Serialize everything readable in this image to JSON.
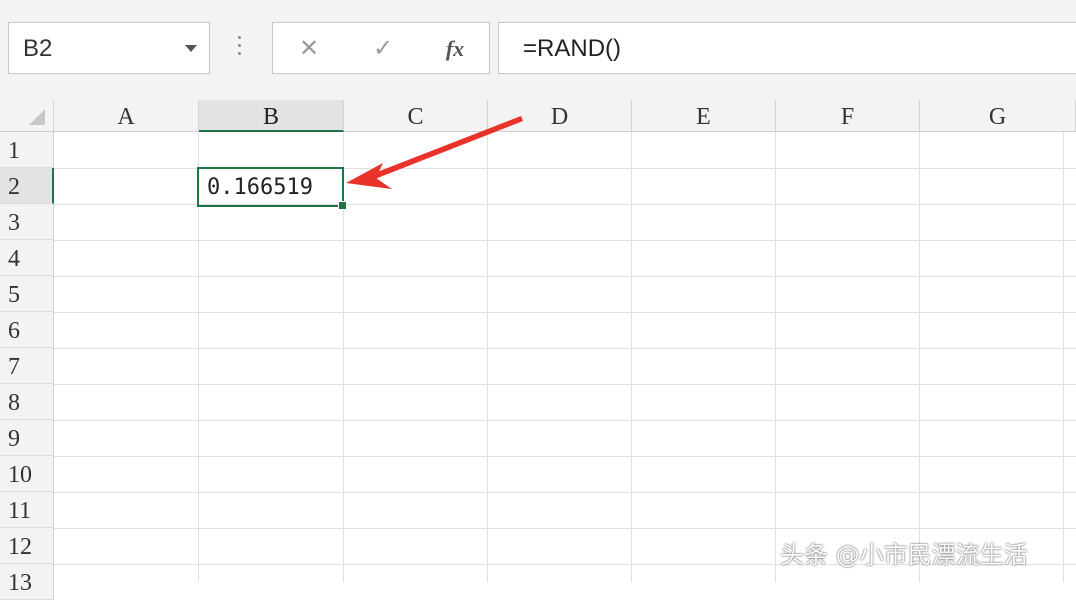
{
  "name_box": {
    "value": "B2"
  },
  "formula_bar": {
    "cancel_glyph": "✕",
    "enter_glyph": "✓",
    "fx_label": "fx",
    "formula": "=RAND()"
  },
  "columns": [
    "A",
    "B",
    "C",
    "D",
    "E",
    "F",
    "G"
  ],
  "rows": [
    "1",
    "2",
    "3",
    "4",
    "5",
    "6",
    "7",
    "8",
    "9",
    "10",
    "11",
    "12",
    "13"
  ],
  "active_cell": {
    "column": "B",
    "row": "2",
    "value": "0.166519"
  },
  "watermark": "头条 @小市民漂流生活",
  "colors": {
    "selection": "#217346",
    "annotation_arrow": "#e8322a"
  },
  "icons": [
    "dropdown-chevron-icon",
    "cancel-icon",
    "enter-check-icon",
    "function-icon",
    "select-all-triangle-icon"
  ]
}
